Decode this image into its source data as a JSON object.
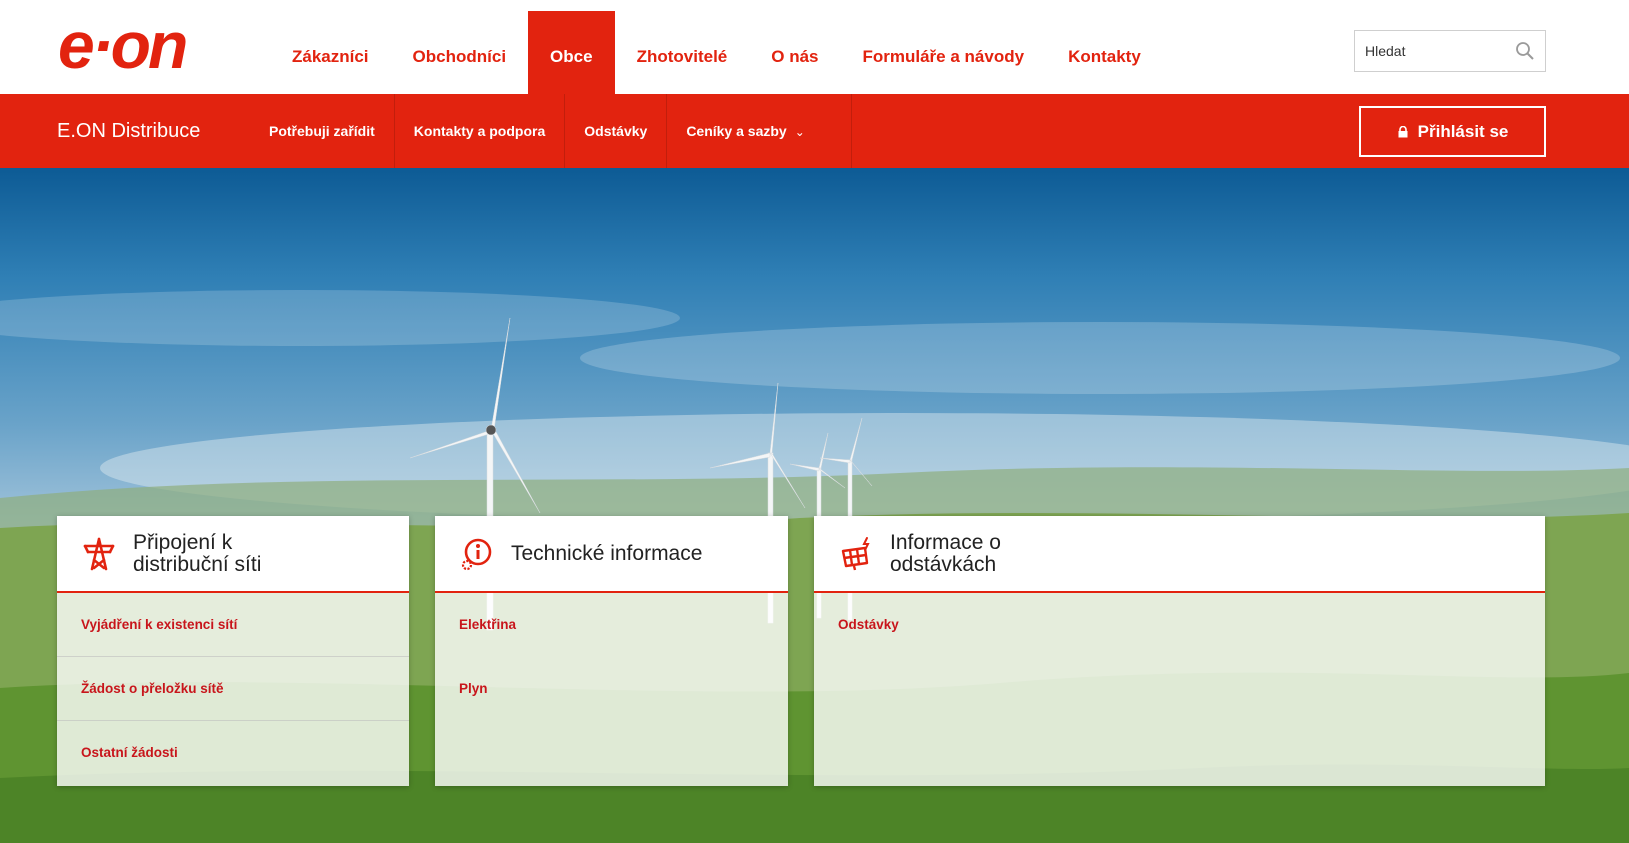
{
  "brand": {
    "logo_text": "e·on",
    "color": "#e2230f"
  },
  "main_nav": {
    "items": [
      {
        "label": "Zákazníci"
      },
      {
        "label": "Obchodníci"
      },
      {
        "label": "Obce",
        "active": true
      },
      {
        "label": "Zhotovitelé"
      },
      {
        "label": "O nás"
      },
      {
        "label": "Formuláře a návody"
      },
      {
        "label": "Kontakty"
      }
    ]
  },
  "search": {
    "placeholder": "Hledat",
    "icon": "search-icon"
  },
  "sub_nav": {
    "brand": "E.ON Distribuce",
    "items": [
      {
        "label": "Potřebuji zařídit"
      },
      {
        "label": "Kontakty a podpora"
      },
      {
        "label": "Odstávky"
      },
      {
        "label": "Ceníky a sazby",
        "dropdown": true,
        "chevron": "⌄"
      }
    ],
    "login_label": "Přihlásit se",
    "login_icon": "lock-icon"
  },
  "cards": [
    {
      "icon": "power-pylon-icon",
      "title_line1": "Připojení k",
      "title_line2": "distribuční síti",
      "links": [
        "Vyjádření k existenci sítí",
        "Žádost o přeložku sítě",
        "Ostatní žádosti"
      ]
    },
    {
      "icon": "technical-info-icon",
      "title": "Technické informace",
      "links": [
        "Elektřina",
        "Plyn"
      ]
    },
    {
      "icon": "solar-outage-icon",
      "title_line1": "Informace o",
      "title_line2": "odstávkách",
      "links": [
        "Odstávky"
      ]
    }
  ]
}
